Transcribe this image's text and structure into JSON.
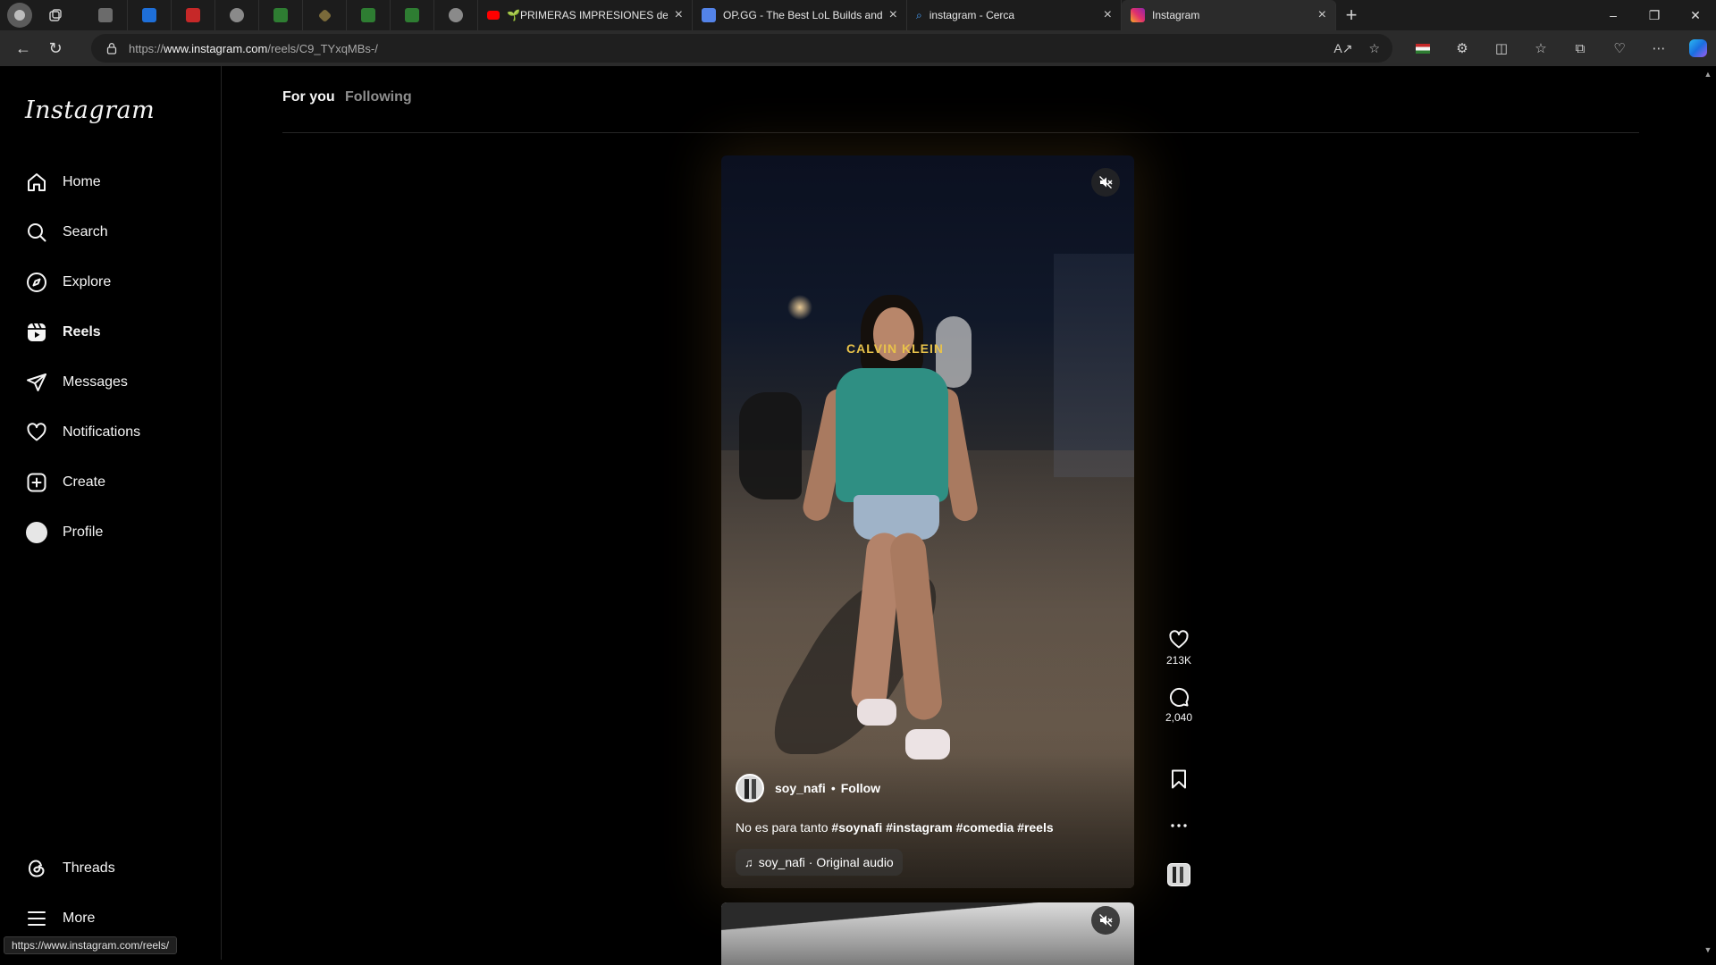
{
  "browser": {
    "pinned_tab_colors": [
      "#6b6b6b",
      "#1e6fd9",
      "#c62828",
      "#8a8a8a",
      "#2e7d32",
      "#7a6a3a",
      "#2e7d32",
      "#2e7d32",
      "#8a8a8a"
    ],
    "tabs": [
      {
        "title": "🌱PRIMERAS IMPRESIONES de K",
        "favicon": "youtube-icon",
        "color": "#ff0000",
        "active": false
      },
      {
        "title": "OP.GG - The Best LoL Builds and T",
        "favicon": "opgg-icon",
        "color": "#5383e8",
        "active": false
      },
      {
        "title": "instagram - Cerca",
        "favicon": "search-icon",
        "color": "#4aa3ff",
        "active": false
      },
      {
        "title": "Instagram",
        "favicon": "instagram-icon",
        "color": "#e1306c",
        "active": true
      }
    ],
    "url_prefix": "https://",
    "url_domain": "www.instagram.com",
    "url_path": "/reels/C9_TYxqMBs-/",
    "status_url": "https://www.instagram.com/reels/"
  },
  "instagram": {
    "logo": "Instagram",
    "nav": [
      {
        "label": "Home",
        "icon": "home-icon"
      },
      {
        "label": "Search",
        "icon": "search-icon"
      },
      {
        "label": "Explore",
        "icon": "compass-icon"
      },
      {
        "label": "Reels",
        "icon": "reels-icon",
        "active": true
      },
      {
        "label": "Messages",
        "icon": "paper-plane-icon"
      },
      {
        "label": "Notifications",
        "icon": "heart-icon"
      },
      {
        "label": "Create",
        "icon": "plus-square-icon"
      },
      {
        "label": "Profile",
        "icon": "avatar-icon"
      }
    ],
    "bottom_nav": [
      {
        "label": "Threads",
        "icon": "threads-icon"
      },
      {
        "label": "More",
        "icon": "hamburger-icon"
      }
    ],
    "feed_tabs": {
      "for_you": "For you",
      "following": "Following"
    },
    "reel": {
      "shirt_text": "CALVIN KLEIN",
      "username": "soy_nafi",
      "dot": "•",
      "follow": "Follow",
      "caption_text": "No es para tanto ",
      "caption_tags": "#soynafi #instagram #comedia #reels",
      "audio": "soy_nafi · Original audio",
      "likes": "213K",
      "comments": "2,040"
    }
  }
}
